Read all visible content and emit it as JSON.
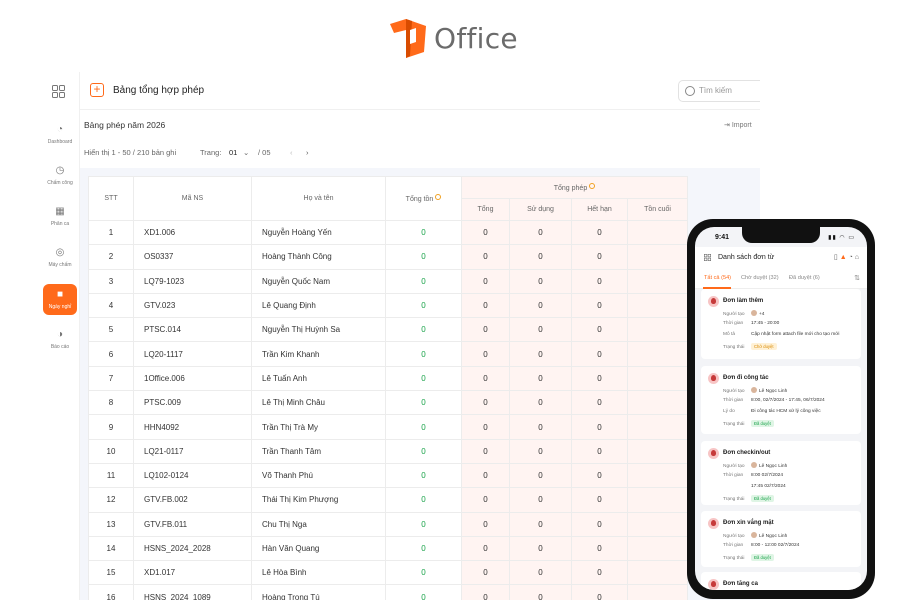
{
  "brand": {
    "name": "Office",
    "accent": "#ff6a1a"
  },
  "sidebar": {
    "items": [
      {
        "label": "Dashboard",
        "icon": "dashboard-icon"
      },
      {
        "label": "Chấm công",
        "icon": "clock-icon"
      },
      {
        "label": "Phân ca",
        "icon": "calendar-icon"
      },
      {
        "label": "Máy chấm",
        "icon": "fingerprint-icon"
      },
      {
        "label": "Ngày nghỉ",
        "icon": "leave-icon",
        "active": true
      },
      {
        "label": "Báo cáo",
        "icon": "report-icon"
      }
    ]
  },
  "header": {
    "title": "Bảng tổng hợp phép",
    "search_placeholder": "Tìm kiếm"
  },
  "subheader": {
    "title": "Bảng phép năm 2026",
    "import_label": "Import"
  },
  "pager": {
    "summary": "Hiển thị 1 - 50 / 210 bản ghi",
    "page_label": "Trang:",
    "page_value": "01",
    "page_total": "/ 05"
  },
  "table": {
    "headers": {
      "stt": "STT",
      "code": "Mã NS",
      "name": "Họ và tên",
      "total_remaining": "Tổng tồn",
      "group": "Tổng phép",
      "total": "Tổng",
      "used": "Sử dụng",
      "expired": "Hết hạn",
      "end_remaining": "Tồn cuối"
    },
    "rows": [
      {
        "stt": "1",
        "code": "XD1.006",
        "name": "Nguyễn Hoàng Yến",
        "remain": "0",
        "total": "0",
        "used": "0",
        "expired": "0"
      },
      {
        "stt": "2",
        "code": "OS0337",
        "name": "Hoàng Thành Công",
        "remain": "0",
        "total": "0",
        "used": "0",
        "expired": "0"
      },
      {
        "stt": "3",
        "code": "LQ79-1023",
        "name": "Nguyễn Quốc Nam",
        "remain": "0",
        "total": "0",
        "used": "0",
        "expired": "0"
      },
      {
        "stt": "4",
        "code": "GTV.023",
        "name": "Lê Quang Định",
        "remain": "0",
        "total": "0",
        "used": "0",
        "expired": "0"
      },
      {
        "stt": "5",
        "code": "PTSC.014",
        "name": "Nguyễn Thị Huỳnh Sa",
        "remain": "0",
        "total": "0",
        "used": "0",
        "expired": "0"
      },
      {
        "stt": "6",
        "code": "LQ20-1117",
        "name": "Trần Kim Khanh",
        "remain": "0",
        "total": "0",
        "used": "0",
        "expired": "0"
      },
      {
        "stt": "7",
        "code": "1Office.006",
        "name": "Lê Tuấn Anh",
        "remain": "0",
        "total": "0",
        "used": "0",
        "expired": "0"
      },
      {
        "stt": "8",
        "code": "PTSC.009",
        "name": "Lê Thị Minh Châu",
        "remain": "0",
        "total": "0",
        "used": "0",
        "expired": "0"
      },
      {
        "stt": "9",
        "code": "HHN4092",
        "name": "Trần Thị Trà My",
        "remain": "0",
        "total": "0",
        "used": "0",
        "expired": "0"
      },
      {
        "stt": "10",
        "code": "LQ21-0117",
        "name": "Trần Thanh Tâm",
        "remain": "0",
        "total": "0",
        "used": "0",
        "expired": "0"
      },
      {
        "stt": "11",
        "code": "LQ102-0124",
        "name": "Võ Thanh Phú",
        "remain": "0",
        "total": "0",
        "used": "0",
        "expired": "0"
      },
      {
        "stt": "12",
        "code": "GTV.FB.002",
        "name": "Thái Thị Kim Phượng",
        "remain": "0",
        "total": "0",
        "used": "0",
        "expired": "0"
      },
      {
        "stt": "13",
        "code": "GTV.FB.011",
        "name": "Chu Thị Nga",
        "remain": "0",
        "total": "0",
        "used": "0",
        "expired": "0"
      },
      {
        "stt": "14",
        "code": "HSNS_2024_2028",
        "name": "Hàn Văn Quang",
        "remain": "0",
        "total": "0",
        "used": "0",
        "expired": "0"
      },
      {
        "stt": "15",
        "code": "XD1.017",
        "name": "Lê Hòa Bình",
        "remain": "0",
        "total": "0",
        "used": "0",
        "expired": "0"
      },
      {
        "stt": "16",
        "code": "HSNS_2024_1089",
        "name": "Hoàng Trọng Tú",
        "remain": "0",
        "total": "0",
        "used": "0",
        "expired": "0"
      }
    ]
  },
  "phone": {
    "time": "9:41",
    "title": "Danh sách đơn từ",
    "tabs": [
      "Tất cả (54)",
      "Chờ duyệt (32)",
      "Đã duyệt (6)"
    ],
    "cards": [
      {
        "title": "Đơn làm thêm",
        "rows": [
          {
            "label": "Người tạo",
            "value": "+4"
          },
          {
            "label": "Thời gian",
            "value": "17:45 - 20:00"
          },
          {
            "label": "Mô tả",
            "value": "Cập nhật form attach file mới cho tạo mới"
          },
          {
            "label": "Trạng thái",
            "status": "Chờ duyệt"
          }
        ]
      },
      {
        "title": "Đơn đi công tác",
        "rows": [
          {
            "label": "Người tạo",
            "value": "Lê Ngọc Linh"
          },
          {
            "label": "Thời gian",
            "value": "8:00, 02/7/2024 - 17:45, 06/7/2024"
          },
          {
            "label": "Lý do",
            "value": "Đi công tác HCM xử lý công việc"
          },
          {
            "label": "Trạng thái",
            "status": "Đã duyệt"
          }
        ]
      },
      {
        "title": "Đơn checkin/out",
        "rows": [
          {
            "label": "Người tạo",
            "value": "Lê Ngọc Linh"
          },
          {
            "label": "Thời gian",
            "value": "8:00    02/7/2024"
          },
          {
            "label": "",
            "value": "17:45    02/7/2024"
          },
          {
            "label": "Trạng thái",
            "status": "Đã duyệt"
          }
        ]
      },
      {
        "title": "Đơn xin vắng mặt",
        "rows": [
          {
            "label": "Người tạo",
            "value": "Lê Ngọc Linh"
          },
          {
            "label": "Thời gian",
            "value": "8:00 - 12:00  02/7/2024"
          },
          {
            "label": "Trạng thái",
            "status": "Đã duyệt"
          }
        ]
      },
      {
        "title": "Đơn tăng ca",
        "rows": []
      }
    ]
  }
}
